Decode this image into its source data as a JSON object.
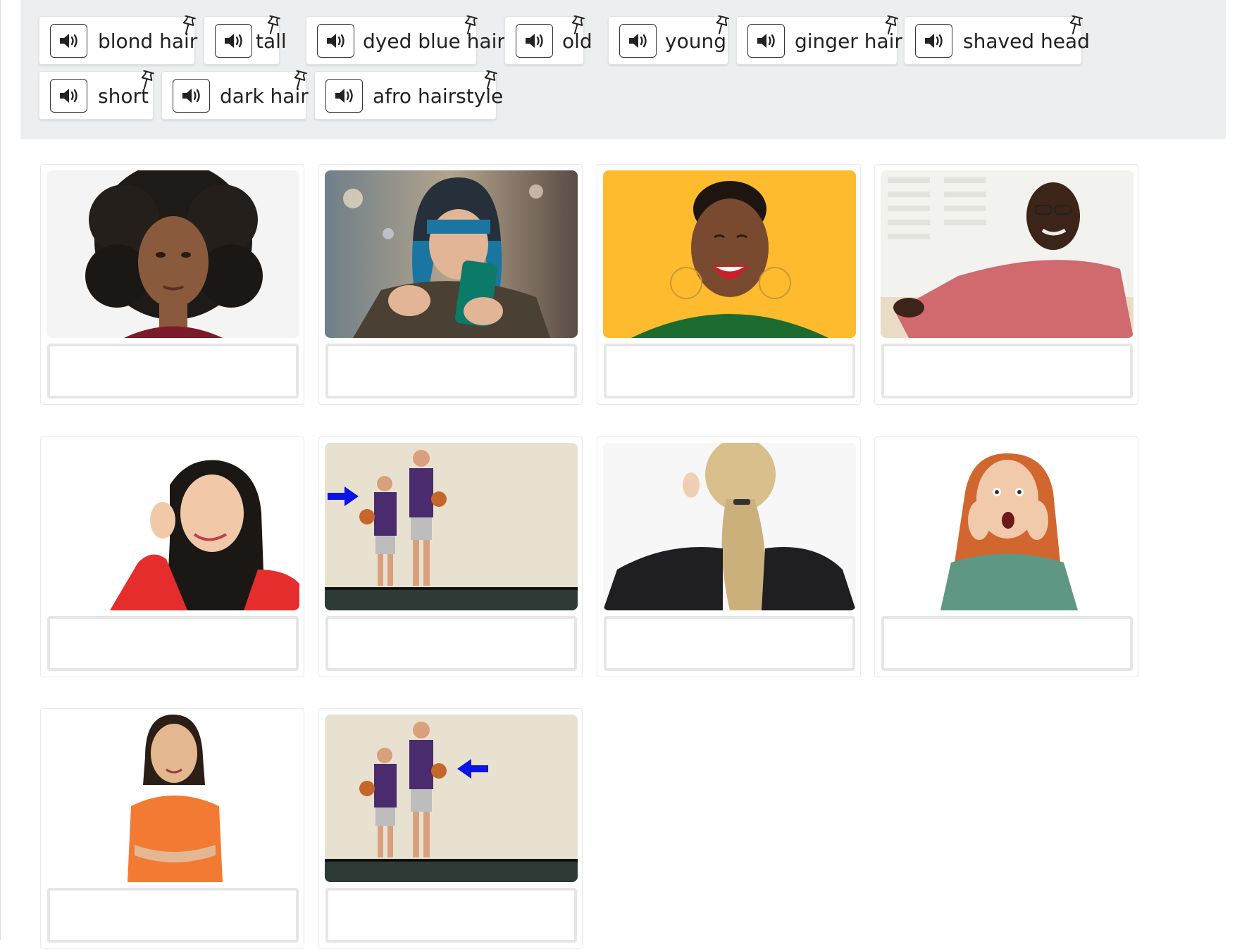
{
  "word_bank": {
    "chips": [
      {
        "label": "blond hair",
        "audio_icon": "speaker-icon",
        "drag_icon": "drag-pin-icon"
      },
      {
        "label": "tall",
        "audio_icon": "speaker-icon",
        "drag_icon": "drag-pin-icon"
      },
      {
        "label": "dyed blue hair",
        "audio_icon": "speaker-icon",
        "drag_icon": "drag-pin-icon"
      },
      {
        "label": "old",
        "audio_icon": "speaker-icon",
        "drag_icon": "drag-pin-icon"
      },
      {
        "label": "young",
        "audio_icon": "speaker-icon",
        "drag_icon": "drag-pin-icon"
      },
      {
        "label": "ginger hair",
        "audio_icon": "speaker-icon",
        "drag_icon": "drag-pin-icon"
      },
      {
        "label": "shaved head",
        "audio_icon": "speaker-icon",
        "drag_icon": "drag-pin-icon"
      },
      {
        "label": "short",
        "audio_icon": "speaker-icon",
        "drag_icon": "drag-pin-icon"
      },
      {
        "label": "dark hair",
        "audio_icon": "speaker-icon",
        "drag_icon": "drag-pin-icon"
      },
      {
        "label": "afro hairstyle",
        "audio_icon": "speaker-icon",
        "drag_icon": "drag-pin-icon"
      }
    ]
  },
  "cards": [
    {
      "image": "woman-afro-photo",
      "answer": ""
    },
    {
      "image": "woman-blue-hair-phone-photo",
      "answer": ""
    },
    {
      "image": "woman-shaved-head-laughing-photo",
      "answer": ""
    },
    {
      "image": "old-man-glasses-sofa-photo",
      "answer": ""
    },
    {
      "image": "woman-dark-hair-listening-photo",
      "answer": ""
    },
    {
      "image": "basketball-players-arrow-short-photo",
      "answer": ""
    },
    {
      "image": "blond-ponytail-back-photo",
      "answer": ""
    },
    {
      "image": "ginger-woman-shocked-photo",
      "answer": ""
    },
    {
      "image": "young-girl-orange-shirt-photo",
      "answer": ""
    },
    {
      "image": "basketball-players-arrow-tall-photo",
      "answer": ""
    }
  ],
  "colors": {
    "word_bank_bg": "#eceeef",
    "drop_border": "#e6e6e6",
    "arrow": "#0a14e6"
  }
}
